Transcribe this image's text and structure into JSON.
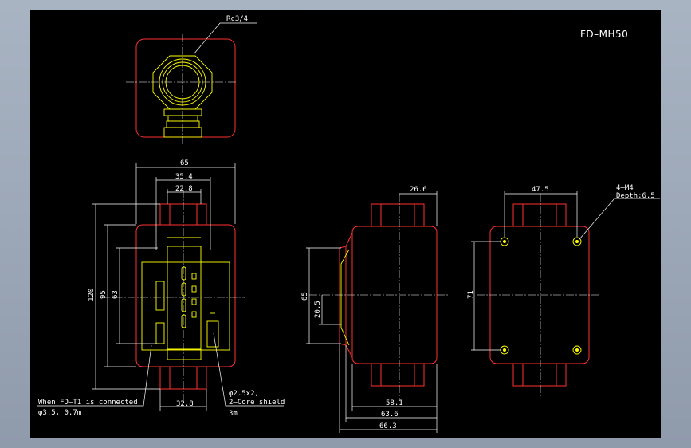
{
  "drawing": {
    "model": "FD–MH50",
    "thread_label": "Rc3/4",
    "dims": {
      "d65_top": "65",
      "d35_4": "35.4",
      "d22_8": "22.8",
      "d120": "120",
      "d95": "95",
      "d63": "63",
      "d32_8": "32.8",
      "d26_6": "26.6",
      "d65_side": "65",
      "d20_5": "20.5",
      "d58_1": "58.1",
      "d63_6": "63.6",
      "d66_3": "66.3",
      "d47_5": "47.5",
      "d71": "71"
    },
    "notes": {
      "m4_line1": "4–M4",
      "m4_line2": "Depth:6.5",
      "connected_line1": "When FD–T1 is connected",
      "connected_line2": "φ3.5, 0.7m",
      "cable_line1": "φ2.5x2,",
      "cable_line2": "2–Core shield",
      "cable_line3": "3m"
    },
    "colors": {
      "background": "#000000",
      "outline": "#ff3030",
      "detail": "#ffff00",
      "dimension": "#ffffff"
    }
  }
}
